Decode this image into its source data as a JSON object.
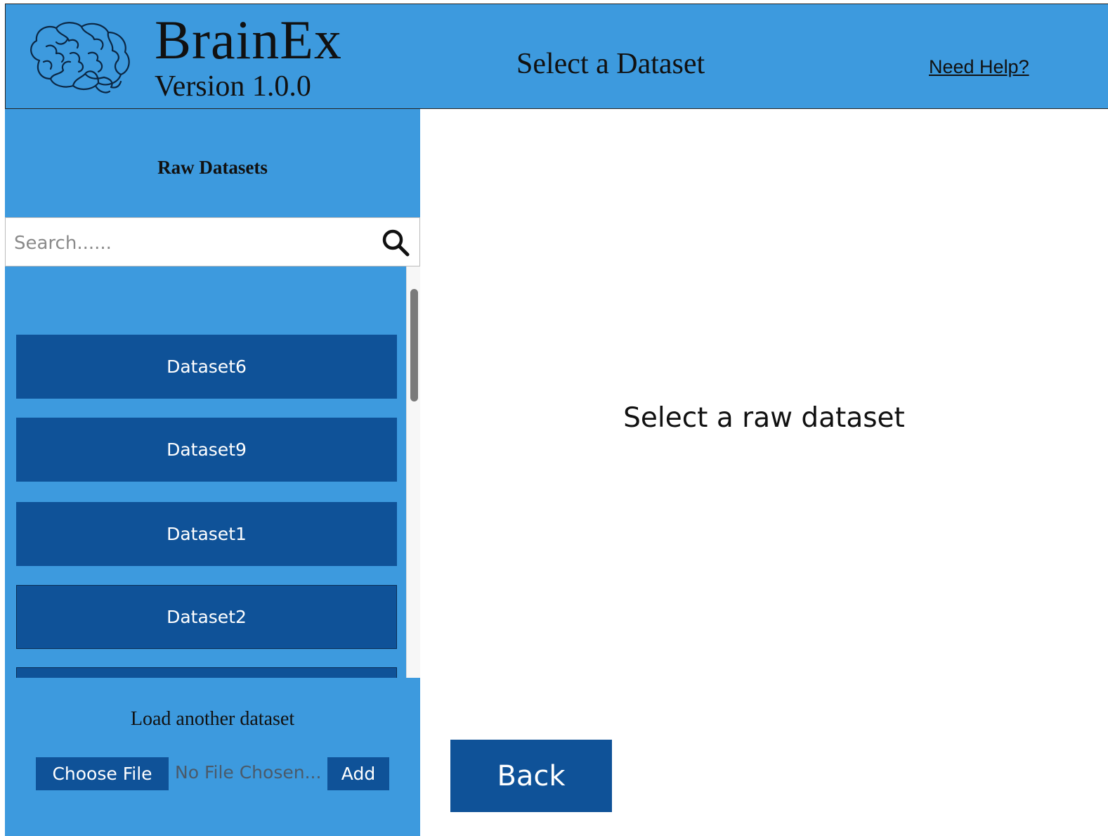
{
  "header": {
    "app_name": "BrainEx",
    "version": "Version 1.0.0",
    "page_title": "Select a Dataset",
    "help_link": "Need Help?",
    "logo_icon": "brain-icon"
  },
  "sidebar": {
    "heading": "Raw Datasets",
    "search": {
      "placeholder": "Search......",
      "value": ""
    },
    "datasets": [
      {
        "label": "Dataset6"
      },
      {
        "label": "Dataset9"
      },
      {
        "label": "Dataset1"
      },
      {
        "label": "Dataset2"
      },
      {
        "label": ""
      }
    ],
    "load_label": "Load another dataset",
    "choose_file_label": "Choose File",
    "file_status": "No File Chosen...",
    "add_label": "Add"
  },
  "main": {
    "message": "Select a raw dataset",
    "back_label": "Back"
  },
  "colors": {
    "primary": "#3d9ade",
    "button": "#0f5298",
    "text": "#111111"
  }
}
